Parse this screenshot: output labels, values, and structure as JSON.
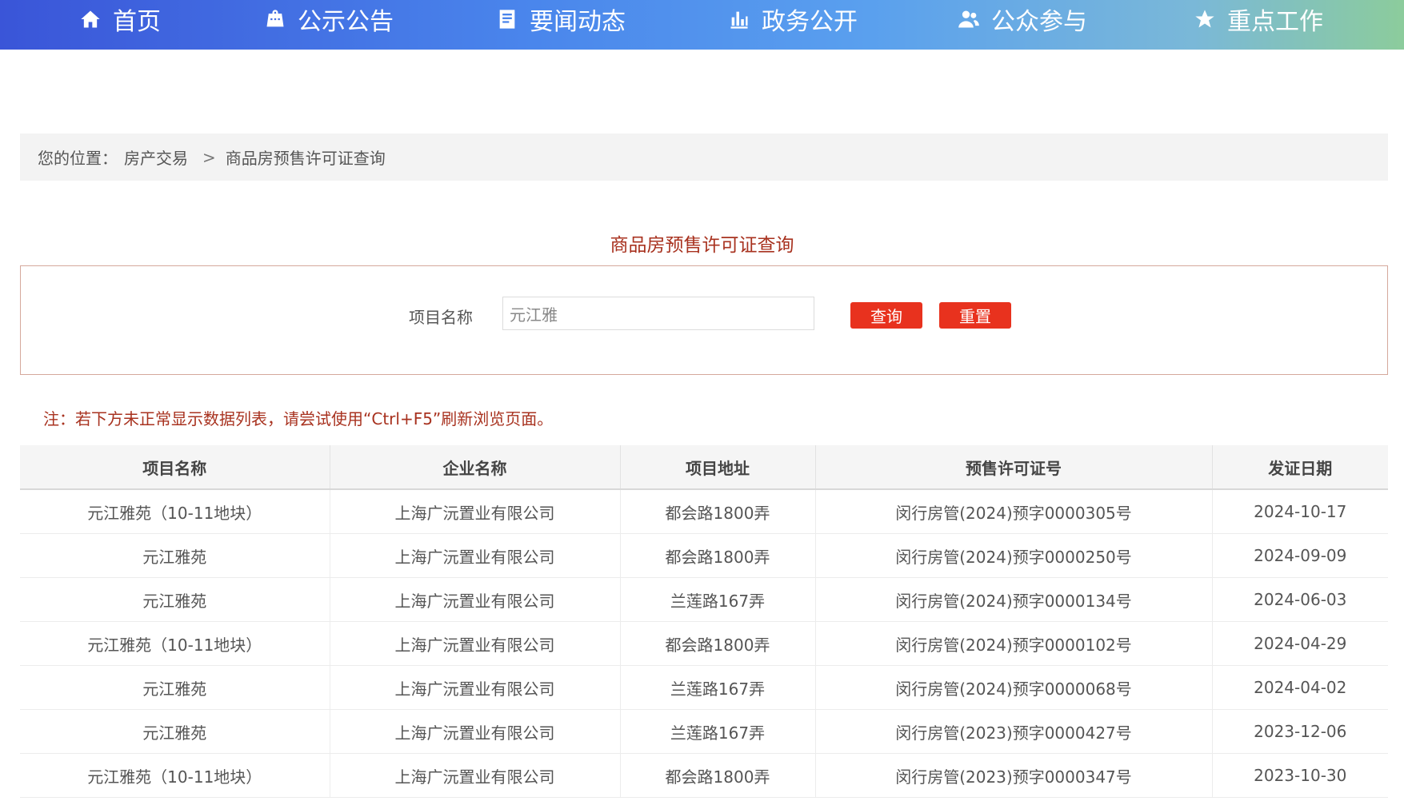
{
  "nav": {
    "items": [
      {
        "label": "首页",
        "icon": "home-icon"
      },
      {
        "label": "公示公告",
        "icon": "notice-icon"
      },
      {
        "label": "要闻动态",
        "icon": "news-icon"
      },
      {
        "label": "政务公开",
        "icon": "stats-icon"
      },
      {
        "label": "公众参与",
        "icon": "users-icon"
      },
      {
        "label": "重点工作",
        "icon": "star-icon"
      }
    ]
  },
  "breadcrumb": {
    "prefix": "您的位置：",
    "level1": "房产交易",
    "separator": ">",
    "current": "商品房预售许可证查询"
  },
  "section": {
    "title": "商品房预售许可证查询"
  },
  "search": {
    "label": "项目名称",
    "value": "元江雅",
    "query_label": "查询",
    "reset_label": "重置"
  },
  "note": "注：若下方未正常显示数据列表，请尝试使用“Ctrl+F5”刷新浏览页面。",
  "table": {
    "headers": [
      "项目名称",
      "企业名称",
      "项目地址",
      "预售许可证号",
      "发证日期"
    ],
    "rows": [
      [
        "元江雅苑（10-11地块）",
        "上海广沅置业有限公司",
        "都会路1800弄",
        "闵行房管(2024)预字0000305号",
        "2024-10-17"
      ],
      [
        "元江雅苑",
        "上海广沅置业有限公司",
        "都会路1800弄",
        "闵行房管(2024)预字0000250号",
        "2024-09-09"
      ],
      [
        "元江雅苑",
        "上海广沅置业有限公司",
        "兰莲路167弄",
        "闵行房管(2024)预字0000134号",
        "2024-06-03"
      ],
      [
        "元江雅苑（10-11地块）",
        "上海广沅置业有限公司",
        "都会路1800弄",
        "闵行房管(2024)预字0000102号",
        "2024-04-29"
      ],
      [
        "元江雅苑",
        "上海广沅置业有限公司",
        "兰莲路167弄",
        "闵行房管(2024)预字0000068号",
        "2024-04-02"
      ],
      [
        "元江雅苑",
        "上海广沅置业有限公司",
        "兰莲路167弄",
        "闵行房管(2023)预字0000427号",
        "2023-12-06"
      ],
      [
        "元江雅苑（10-11地块）",
        "上海广沅置业有限公司",
        "都会路1800弄",
        "闵行房管(2023)预字0000347号",
        "2023-10-30"
      ]
    ]
  },
  "colors": {
    "accent": "#e8321e",
    "title": "#a8321f",
    "nav_start": "#3a55d8",
    "nav_end": "#8ccc9c"
  }
}
